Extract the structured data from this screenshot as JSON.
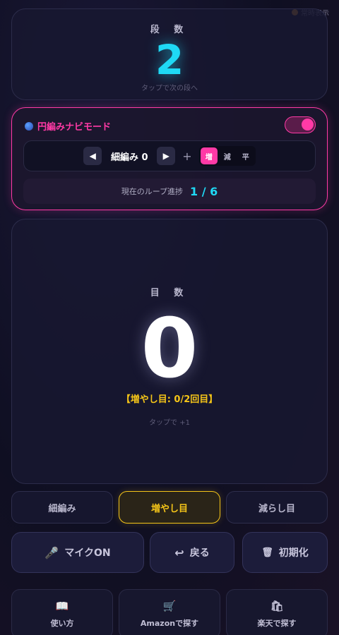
{
  "always_on": {
    "label": "常時表示"
  },
  "row_counter": {
    "label": "段 数",
    "value": "2",
    "hint": "タップで次の段へ"
  },
  "round_nav": {
    "title": "円編みナビモード",
    "toggle_on": true,
    "stitch_label": "細編み 0",
    "plus": "+",
    "modes": [
      "増",
      "減",
      "平"
    ],
    "active_mode": "増",
    "loop_label": "現在のループ進捗",
    "loop_value": "1 / 6"
  },
  "stitch_counter": {
    "label": "目 数",
    "value": "0",
    "sub": "【増やし目: 0/2回目】",
    "hint": "タップで +1"
  },
  "stitch_types": [
    {
      "label": "細編み",
      "active": false
    },
    {
      "label": "増やし目",
      "active": true
    },
    {
      "label": "減らし目",
      "active": false
    }
  ],
  "actions": {
    "mic": {
      "label": "マイクON",
      "icon": "microphone-icon"
    },
    "back": {
      "label": "戻る",
      "icon": "undo-icon"
    },
    "reset": {
      "label": "初期化",
      "icon": "trash-icon"
    }
  },
  "links": [
    {
      "label": "使い方",
      "icon": "book-icon"
    },
    {
      "label": "Amazonで探す",
      "icon": "cart-icon"
    },
    {
      "label": "楽天で探す",
      "icon": "shopping-bag-icon"
    }
  ],
  "colors": {
    "accent_pink": "#ff3aa6",
    "accent_cyan": "#1fd9f5",
    "accent_yellow": "#f5c518"
  }
}
